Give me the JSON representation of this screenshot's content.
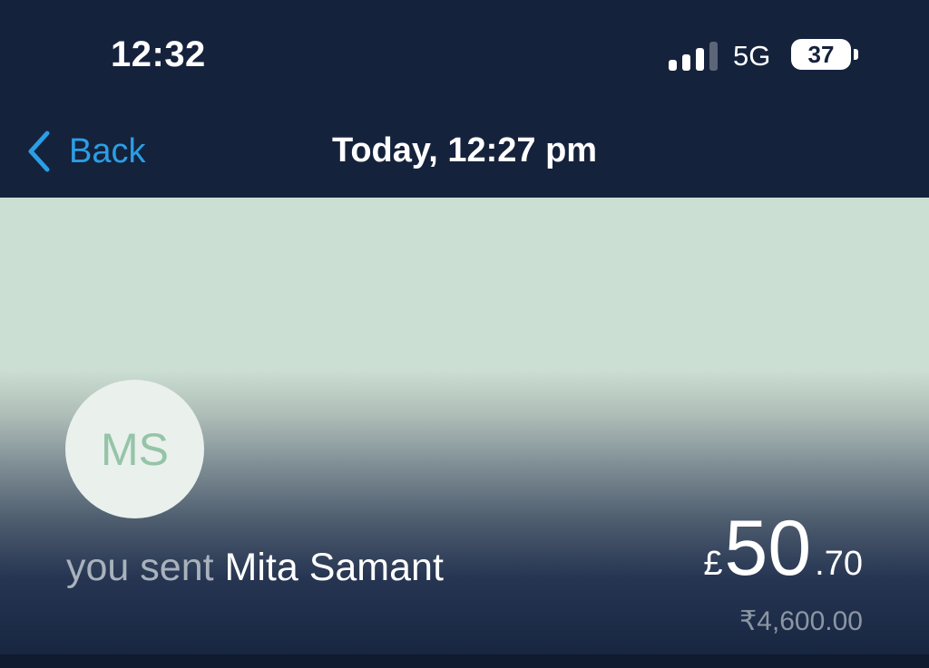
{
  "status_bar": {
    "time": "12:32",
    "network": "5G",
    "battery": "37"
  },
  "nav": {
    "back_label": "Back",
    "title": "Today, 12:27 pm"
  },
  "transaction": {
    "initials": "MS",
    "prefix": "you sent",
    "recipient": "Mita Samant",
    "currency_symbol": "£",
    "amount_major": "50",
    "amount_minor": ".70",
    "converted_amount": "₹4,600.00"
  },
  "colors": {
    "nav_bg": "#15223c",
    "accent": "#2b9ee4",
    "hero_top": "#ccdfd3",
    "avatar_text": "#95c4a8"
  }
}
